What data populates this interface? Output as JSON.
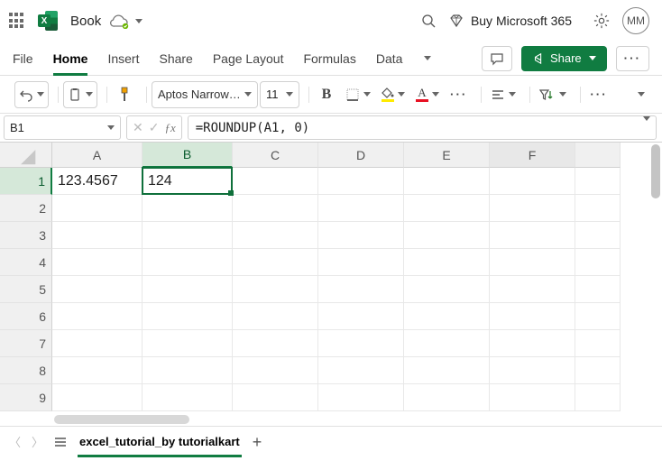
{
  "title": {
    "doc_name": "Book",
    "avatar": "MM",
    "buy_label": "Buy Microsoft 365"
  },
  "tabs": {
    "file": "File",
    "home": "Home",
    "insert": "Insert",
    "share": "Share",
    "page_layout": "Page Layout",
    "formulas": "Formulas",
    "data": "Data",
    "share_btn": "Share"
  },
  "toolbar": {
    "font_name": "Aptos Narrow (...",
    "font_size": "11",
    "bold": "B",
    "font_letter": "A"
  },
  "fx": {
    "name_box": "B1",
    "formula": "=ROUNDUP(A1, 0)"
  },
  "columns": [
    "A",
    "B",
    "C",
    "D",
    "E",
    "F"
  ],
  "rows": [
    "1",
    "2",
    "3",
    "4",
    "5",
    "6",
    "7",
    "8",
    "9"
  ],
  "cells": {
    "A1": "123.4567",
    "B1": "124"
  },
  "sheet": {
    "name": "excel_tutorial_by tutorialkart"
  }
}
